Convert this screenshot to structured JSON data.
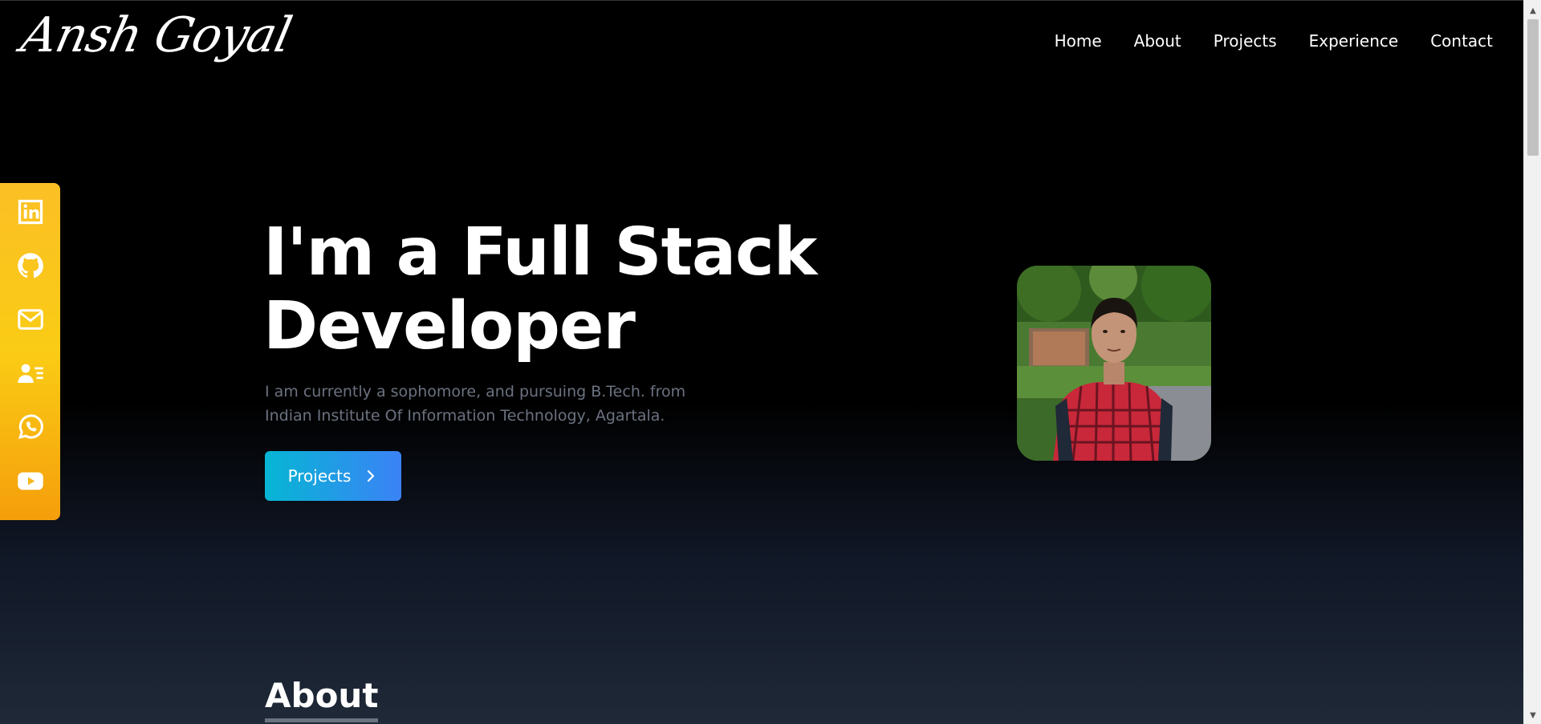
{
  "header": {
    "logo": "Ansh Goyal",
    "nav": [
      {
        "label": "Home"
      },
      {
        "label": "About"
      },
      {
        "label": "Projects"
      },
      {
        "label": "Experience"
      },
      {
        "label": "Contact"
      }
    ]
  },
  "social": [
    {
      "icon": "linkedin-icon"
    },
    {
      "icon": "github-icon"
    },
    {
      "icon": "mail-icon"
    },
    {
      "icon": "resume-icon"
    },
    {
      "icon": "whatsapp-icon"
    },
    {
      "icon": "youtube-icon"
    }
  ],
  "hero": {
    "title_line1": "I'm a Full Stack",
    "title_line2": "Developer",
    "desc_line1": "I am currently a sophomore, and pursuing B.Tech. from",
    "desc_line2": "Indian Institute Of Information Technology, Agartala.",
    "button_label": "Projects"
  },
  "about": {
    "heading": "About"
  },
  "colors": {
    "accent_start": "#06b6d4",
    "accent_end": "#3b82f6",
    "social_bar": "#fbbf24",
    "text_muted": "#6b7280"
  }
}
